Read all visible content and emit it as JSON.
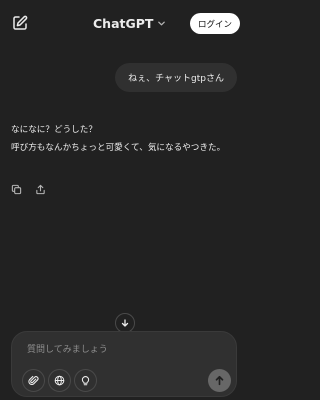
{
  "header": {
    "title": "ChatGPT",
    "login_label": "ログイン"
  },
  "conversation": {
    "user_message": "ねぇ、チャットgtpさん",
    "assistant_lines": [
      "なになに？どうした？",
      "呼び方もなんかちょっと可愛くて、気になるやつきた。"
    ]
  },
  "composer": {
    "placeholder": "質問してみましょう"
  },
  "icons": {
    "new_chat": "edit-icon",
    "model_menu": "chevron-down-icon",
    "copy": "copy-icon",
    "share": "share-icon",
    "scroll": "arrow-down-icon",
    "attach": "paperclip-icon",
    "search": "globe-icon",
    "reason": "lightbulb-icon",
    "send": "arrow-up-icon"
  },
  "colors": {
    "background": "#212121",
    "bubble": "#303030",
    "text": "#ececec",
    "placeholder": "#8e8e8e",
    "login_bg": "#ffffff",
    "send_bg": "#676767"
  }
}
